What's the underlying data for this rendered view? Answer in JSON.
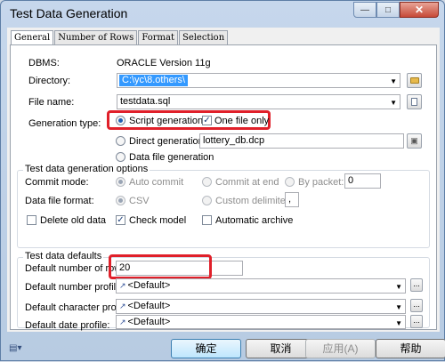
{
  "window": {
    "title": "Test Data Generation"
  },
  "tabs": [
    "General",
    "Number of Rows",
    "Format",
    "Selection"
  ],
  "general": {
    "dbms_label": "DBMS:",
    "dbms_value": "ORACLE Version 11g",
    "directory_label": "Directory:",
    "directory_value": "C:\\yc\\8.others\\",
    "filename_label": "File name:",
    "filename_value": "testdata.sql",
    "gentype_label": "Generation type:",
    "script_gen": "Script generation",
    "one_file_only": "One file only",
    "direct_gen": "Direct generation:",
    "direct_value": "lottery_db.dcp",
    "data_file_gen": "Data file generation"
  },
  "options": {
    "title": "Test data generation options",
    "commit_mode_label": "Commit mode:",
    "auto_commit": "Auto commit",
    "commit_at_end": "Commit at end",
    "by_packet": "By packet:",
    "packet_value": "0",
    "data_format_label": "Data file format:",
    "csv": "CSV",
    "custom_delim": "Custom delimiter:",
    "delim_value": ",",
    "delete_old": "Delete old data",
    "check_model": "Check model",
    "auto_archive": "Automatic archive"
  },
  "defaults": {
    "title": "Test data defaults",
    "rows_label": "Default number of rows:",
    "rows_value": "20",
    "number_profile_label": "Default number profile:",
    "char_profile_label": "Default character profile:",
    "date_profile_label": "Default date profile:",
    "profile_value": "<Default>",
    "dots": "..."
  },
  "buttons": {
    "ok": "确定",
    "cancel": "取消",
    "apply": "应用(A)",
    "help": "帮助"
  },
  "colors": {
    "highlight": "#e0202a",
    "selection": "#3399ff"
  }
}
